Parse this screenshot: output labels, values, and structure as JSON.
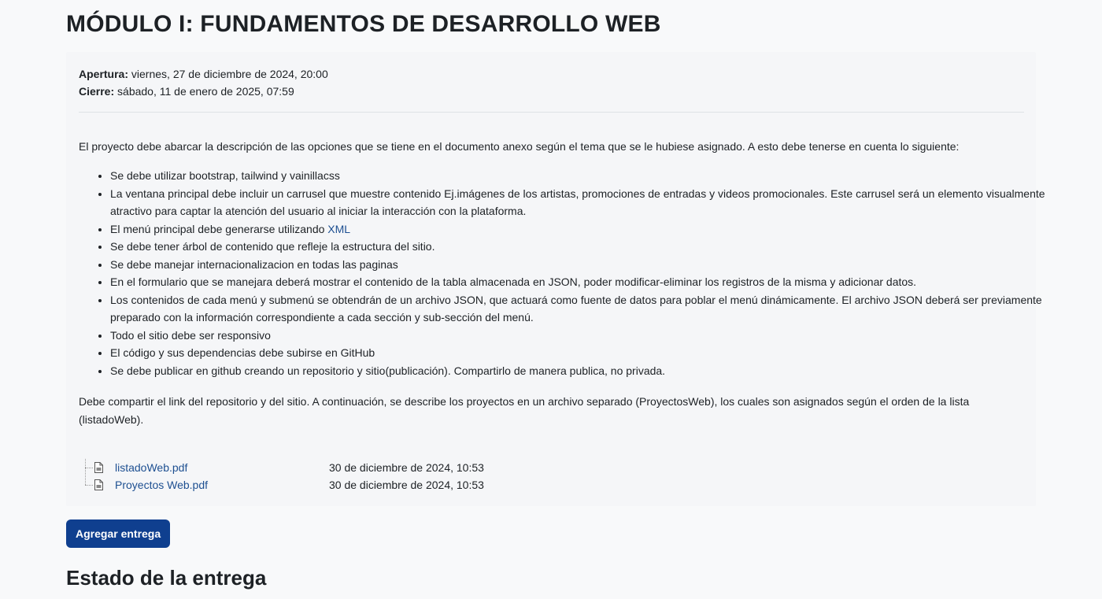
{
  "page_title": "MÓDULO I: FUNDAMENTOS DE DESARROLLO WEB",
  "dates": {
    "open_label": "Apertura:",
    "open_value": " viernes, 27 de diciembre de 2024, 20:00",
    "close_label": "Cierre:",
    "close_value": " sábado, 11 de enero de 2025, 07:59"
  },
  "description": {
    "intro": "El proyecto debe abarcar la descripción de las opciones que se tiene en el documento anexo según el tema que se le hubiese asignado. A esto debe tenerse en cuenta lo siguiente:",
    "items": [
      "Se debe utilizar bootstrap, tailwind y vainillacss",
      "La ventana principal debe incluir un carrusel que muestre contenido Ej.imágenes de los artistas, promociones de entradas y videos promocionales. Este carrusel será un elemento visualmente atractivo para captar la atención del usuario al iniciar la interacción con la plataforma.",
      "El menú principal debe generarse utilizando ",
      "Se debe tener árbol de contenido que refleje la estructura del sitio.",
      "Se debe manejar internacionalizacion en todas las paginas",
      "En el formulario que se manejara deberá mostrar el contenido de la tabla almacenada en JSON, poder modificar-eliminar los registros de la misma y adicionar datos.",
      "Los contenidos de cada menú y submenú se obtendrán de un archivo JSON, que actuará como fuente de datos para poblar el menú dinámicamente. El archivo JSON deberá ser previamente preparado con la información correspondiente a cada sección y sub-sección del menú.",
      "Todo el sitio debe ser responsivo",
      "El código y sus dependencias debe subirse en GitHub",
      "Se debe publicar en github creando un repositorio y sitio(publicación). Compartirlo de manera publica, no privada."
    ],
    "xml_link": "XML",
    "closing": "Debe compartir el link del repositorio y del sitio. A continuación, se describe los proyectos en un archivo separado (ProyectosWeb), los cuales son asignados según el orden de la lista (listadoWeb)."
  },
  "files": [
    {
      "name": "listadoWeb.pdf",
      "date": "30 de diciembre de 2024, 10:53",
      "icon": "pdf-file-icon"
    },
    {
      "name": "Proyectos Web.pdf",
      "date": "30 de diciembre de 2024, 10:53",
      "icon": "pdf-file-icon"
    }
  ],
  "submit_button": "Agregar entrega",
  "status_section_title": "Estado de la entrega",
  "colors": {
    "background": "#f8f9fa",
    "link": "#1d4f91",
    "primary_button": "#0f3f8f"
  }
}
